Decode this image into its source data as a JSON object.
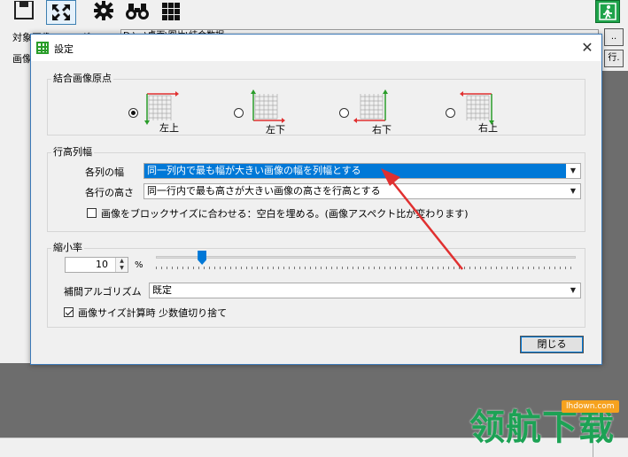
{
  "main_window": {
    "target_folder_label": "対象画像フォルダ",
    "target_folder_value": "D:\\...\\桌面\\图片\\结合数据",
    "image_row_label": "画像",
    "browse_button_label": "..",
    "row_button_label": "行."
  },
  "dialog": {
    "title": "設定",
    "close_glyph": "✕",
    "origin_group": {
      "title": "結合画像原点",
      "options": [
        {
          "label": "左上",
          "checked": true
        },
        {
          "label": "左下",
          "checked": false
        },
        {
          "label": "右下",
          "checked": false
        },
        {
          "label": "右上",
          "checked": false
        }
      ]
    },
    "rowcol_group": {
      "title": "行高列幅",
      "col_width_label": "各列の幅",
      "col_width_value": "同一列内で最も幅が大きい画像の幅を列幅とする",
      "row_height_label": "各行の高さ",
      "row_height_value": "同一行内で最も高さが大きい画像の高さを行高とする",
      "fit_block_label": "画像をブロックサイズに合わせる：空白を埋める。(画像アスペクト比が変わります)",
      "fit_block_checked": false
    },
    "scale_group": {
      "title": "縮小率",
      "scale_value": "10",
      "scale_unit": "%",
      "slider_fraction": 0.11,
      "interp_label": "補間アルゴリズム",
      "interp_value": "既定",
      "truncate_label": "画像サイズ計算時 少数値切り捨て",
      "truncate_checked": true
    },
    "close_button_label": "閉じる"
  },
  "watermark": {
    "badge": "lhdown.com",
    "text": "领航下载"
  },
  "colors": {
    "accent": "#0078d7",
    "annotation_arrow": "#e03030",
    "watermark_green": "#1da255",
    "dialog_border": "#3d7ab8"
  },
  "icons": [
    "save-icon",
    "expand-arrows-icon",
    "gear-icon",
    "binoculars-icon",
    "grid-icon",
    "exit-icon",
    "close-icon",
    "dropdown-arrow-icon",
    "spin-arrows-icon"
  ]
}
